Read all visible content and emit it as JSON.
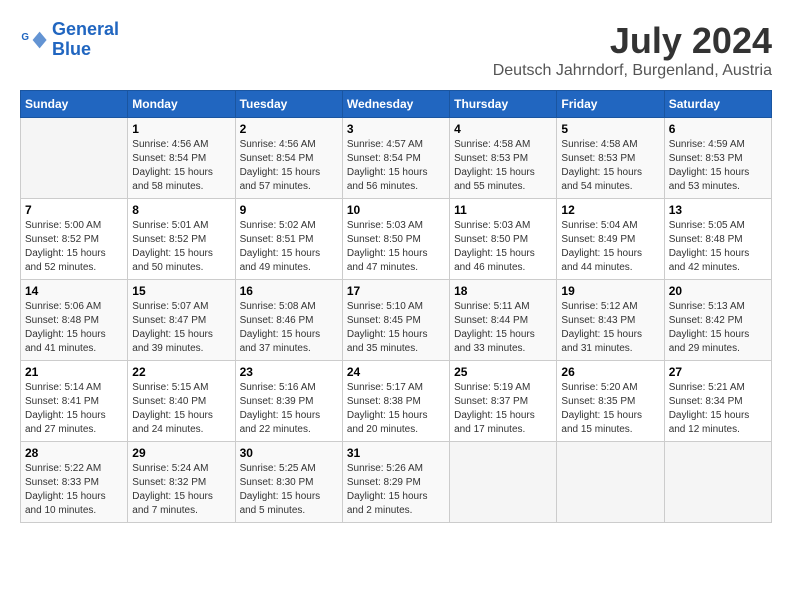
{
  "logo": {
    "line1": "General",
    "line2": "Blue"
  },
  "title": "July 2024",
  "subtitle": "Deutsch Jahrndorf, Burgenland, Austria",
  "days_of_week": [
    "Sunday",
    "Monday",
    "Tuesday",
    "Wednesday",
    "Thursday",
    "Friday",
    "Saturday"
  ],
  "weeks": [
    [
      {
        "day": "",
        "info": ""
      },
      {
        "day": "1",
        "info": "Sunrise: 4:56 AM\nSunset: 8:54 PM\nDaylight: 15 hours\nand 58 minutes."
      },
      {
        "day": "2",
        "info": "Sunrise: 4:56 AM\nSunset: 8:54 PM\nDaylight: 15 hours\nand 57 minutes."
      },
      {
        "day": "3",
        "info": "Sunrise: 4:57 AM\nSunset: 8:54 PM\nDaylight: 15 hours\nand 56 minutes."
      },
      {
        "day": "4",
        "info": "Sunrise: 4:58 AM\nSunset: 8:53 PM\nDaylight: 15 hours\nand 55 minutes."
      },
      {
        "day": "5",
        "info": "Sunrise: 4:58 AM\nSunset: 8:53 PM\nDaylight: 15 hours\nand 54 minutes."
      },
      {
        "day": "6",
        "info": "Sunrise: 4:59 AM\nSunset: 8:53 PM\nDaylight: 15 hours\nand 53 minutes."
      }
    ],
    [
      {
        "day": "7",
        "info": "Sunrise: 5:00 AM\nSunset: 8:52 PM\nDaylight: 15 hours\nand 52 minutes."
      },
      {
        "day": "8",
        "info": "Sunrise: 5:01 AM\nSunset: 8:52 PM\nDaylight: 15 hours\nand 50 minutes."
      },
      {
        "day": "9",
        "info": "Sunrise: 5:02 AM\nSunset: 8:51 PM\nDaylight: 15 hours\nand 49 minutes."
      },
      {
        "day": "10",
        "info": "Sunrise: 5:03 AM\nSunset: 8:50 PM\nDaylight: 15 hours\nand 47 minutes."
      },
      {
        "day": "11",
        "info": "Sunrise: 5:03 AM\nSunset: 8:50 PM\nDaylight: 15 hours\nand 46 minutes."
      },
      {
        "day": "12",
        "info": "Sunrise: 5:04 AM\nSunset: 8:49 PM\nDaylight: 15 hours\nand 44 minutes."
      },
      {
        "day": "13",
        "info": "Sunrise: 5:05 AM\nSunset: 8:48 PM\nDaylight: 15 hours\nand 42 minutes."
      }
    ],
    [
      {
        "day": "14",
        "info": "Sunrise: 5:06 AM\nSunset: 8:48 PM\nDaylight: 15 hours\nand 41 minutes."
      },
      {
        "day": "15",
        "info": "Sunrise: 5:07 AM\nSunset: 8:47 PM\nDaylight: 15 hours\nand 39 minutes."
      },
      {
        "day": "16",
        "info": "Sunrise: 5:08 AM\nSunset: 8:46 PM\nDaylight: 15 hours\nand 37 minutes."
      },
      {
        "day": "17",
        "info": "Sunrise: 5:10 AM\nSunset: 8:45 PM\nDaylight: 15 hours\nand 35 minutes."
      },
      {
        "day": "18",
        "info": "Sunrise: 5:11 AM\nSunset: 8:44 PM\nDaylight: 15 hours\nand 33 minutes."
      },
      {
        "day": "19",
        "info": "Sunrise: 5:12 AM\nSunset: 8:43 PM\nDaylight: 15 hours\nand 31 minutes."
      },
      {
        "day": "20",
        "info": "Sunrise: 5:13 AM\nSunset: 8:42 PM\nDaylight: 15 hours\nand 29 minutes."
      }
    ],
    [
      {
        "day": "21",
        "info": "Sunrise: 5:14 AM\nSunset: 8:41 PM\nDaylight: 15 hours\nand 27 minutes."
      },
      {
        "day": "22",
        "info": "Sunrise: 5:15 AM\nSunset: 8:40 PM\nDaylight: 15 hours\nand 24 minutes."
      },
      {
        "day": "23",
        "info": "Sunrise: 5:16 AM\nSunset: 8:39 PM\nDaylight: 15 hours\nand 22 minutes."
      },
      {
        "day": "24",
        "info": "Sunrise: 5:17 AM\nSunset: 8:38 PM\nDaylight: 15 hours\nand 20 minutes."
      },
      {
        "day": "25",
        "info": "Sunrise: 5:19 AM\nSunset: 8:37 PM\nDaylight: 15 hours\nand 17 minutes."
      },
      {
        "day": "26",
        "info": "Sunrise: 5:20 AM\nSunset: 8:35 PM\nDaylight: 15 hours\nand 15 minutes."
      },
      {
        "day": "27",
        "info": "Sunrise: 5:21 AM\nSunset: 8:34 PM\nDaylight: 15 hours\nand 12 minutes."
      }
    ],
    [
      {
        "day": "28",
        "info": "Sunrise: 5:22 AM\nSunset: 8:33 PM\nDaylight: 15 hours\nand 10 minutes."
      },
      {
        "day": "29",
        "info": "Sunrise: 5:24 AM\nSunset: 8:32 PM\nDaylight: 15 hours\nand 7 minutes."
      },
      {
        "day": "30",
        "info": "Sunrise: 5:25 AM\nSunset: 8:30 PM\nDaylight: 15 hours\nand 5 minutes."
      },
      {
        "day": "31",
        "info": "Sunrise: 5:26 AM\nSunset: 8:29 PM\nDaylight: 15 hours\nand 2 minutes."
      },
      {
        "day": "",
        "info": ""
      },
      {
        "day": "",
        "info": ""
      },
      {
        "day": "",
        "info": ""
      }
    ]
  ]
}
